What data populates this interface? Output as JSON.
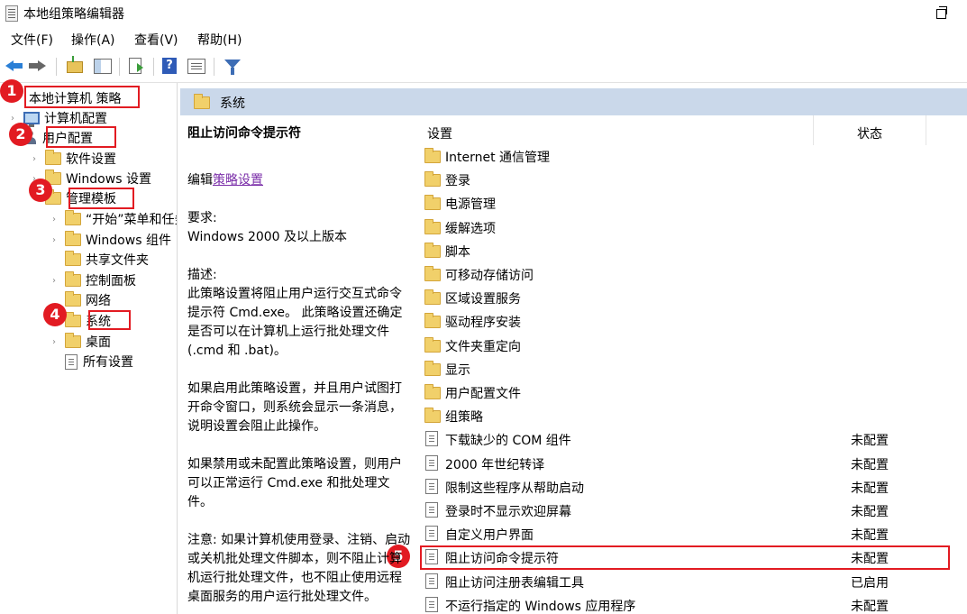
{
  "window": {
    "title": "本地组策略编辑器"
  },
  "menu": [
    "文件(F)",
    "操作(A)",
    "查看(V)",
    "帮助(H)"
  ],
  "tree": {
    "root": "本地计算机 策略",
    "computer_config": "计算机配置",
    "user_config": "用户配置",
    "software_settings": "软件设置",
    "windows_settings": "Windows 设置",
    "admin_templates": "管理模板",
    "start_menu": "“开始”菜单和任务栏",
    "windows_components": "Windows 组件",
    "shared_folders": "共享文件夹",
    "control_panel": "控制面板",
    "network": "网络",
    "system": "系统",
    "desktop": "桌面",
    "all_settings": "所有设置"
  },
  "badges": [
    "1",
    "2",
    "3",
    "4",
    "5"
  ],
  "header": {
    "title": "系统"
  },
  "description": {
    "title": "阻止访问命令提示符",
    "edit_prefix": "编辑",
    "edit_link": "策略设置",
    "req_label": "要求:",
    "req_value": "Windows 2000 及以上版本",
    "desc_label": "描述:",
    "desc_text": "此策略设置将阻止用户运行交互式命令提示符 Cmd.exe。 此策略设置还确定是否可以在计算机上运行批处理文件(.cmd 和 .bat)。",
    "enabled_text": "如果启用此策略设置，并且用户试图打开命令窗口，则系统会显示一条消息，说明设置会阻止此操作。",
    "disabled_text": "如果禁用或未配置此策略设置，则用户可以正常运行 Cmd.exe 和批处理文件。",
    "note_text": "注意: 如果计算机使用登录、注销、启动或关机批处理文件脚本，则不阻止计算机运行批处理文件，也不阻止使用远程桌面服务的用户运行批处理文件。"
  },
  "list": {
    "col_setting": "设置",
    "col_state": "状态",
    "folders": [
      "Internet 通信管理",
      "登录",
      "电源管理",
      "缓解选项",
      "脚本",
      "可移动存储访问",
      "区域设置服务",
      "驱动程序安装",
      "文件夹重定向",
      "显示",
      "用户配置文件",
      "组策略"
    ],
    "policies": [
      {
        "name": "下载缺少的 COM 组件",
        "state": "未配置"
      },
      {
        "name": "2000 年世纪转译",
        "state": "未配置"
      },
      {
        "name": "限制这些程序从帮助启动",
        "state": "未配置"
      },
      {
        "name": "登录时不显示欢迎屏幕",
        "state": "未配置"
      },
      {
        "name": "自定义用户界面",
        "state": "未配置"
      },
      {
        "name": "阻止访问命令提示符",
        "state": "未配置"
      },
      {
        "name": "阻止访问注册表编辑工具",
        "state": "已启用"
      },
      {
        "name": "不运行指定的 Windows 应用程序",
        "state": "未配置"
      }
    ]
  },
  "colors": {
    "accent_red": "#e21b22",
    "header_bar": "#cad8ea",
    "link": "#7b2fa9"
  }
}
